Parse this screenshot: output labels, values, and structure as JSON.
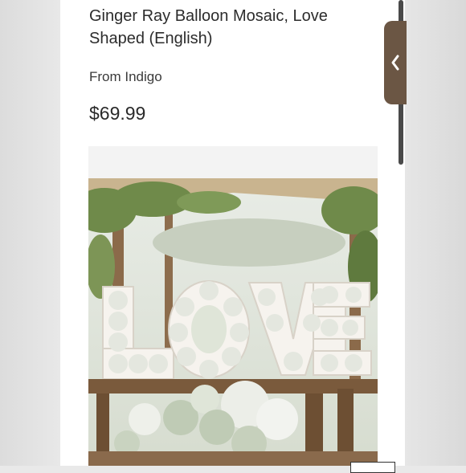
{
  "product": {
    "title": "Ginger Ray Balloon Mosaic, Love Shaped (English)",
    "vendor": "From Indigo",
    "price": "$69.99"
  },
  "side_tab": {
    "icon": "chevron-left-icon"
  },
  "photo": {
    "sign_text": "LOVE",
    "colors": {
      "canopy": "#c9b48f",
      "foliage": "#6f8a4a",
      "balloon": "#dfe5d8",
      "frame": "#f6f3ee",
      "table": "#7a5a3c",
      "sage": "#bfcbb5"
    }
  }
}
